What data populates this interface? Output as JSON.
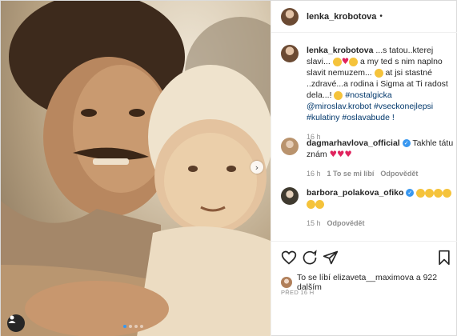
{
  "post": {
    "username": "lenka_krobotova",
    "header_dot": "•",
    "caption": {
      "text_1": "...s tatou..kterej slavi...",
      "text_2": "a my ted s nim naplno slavit nemuzem...",
      "text_3": "at jsi stastné ..zdravé...a rodina i Sigma at Ti radost dela...!",
      "hashtags": "#nostalgicka @miroslav.krobot #vsecko­nejlepsi #kulatiny #oslavabude !",
      "time": "16 h"
    },
    "comments": [
      {
        "username": "dagmarhavlova_official",
        "text": "Takhle tátu znám",
        "time": "16 h",
        "likes": "1 To se mi líbí",
        "reply": "Odpovědět"
      },
      {
        "username": "barbora_polakova_ofiko",
        "text": "",
        "time": "15 h",
        "reply": "Odpovědět"
      }
    ],
    "likes_text": "To se líbí elizaveta__maximova a 922 dalším",
    "posted": "PŘED 16 H"
  },
  "colors": {
    "accent": "#3897f0",
    "heart": "#e0245e",
    "link": "#00376b"
  }
}
